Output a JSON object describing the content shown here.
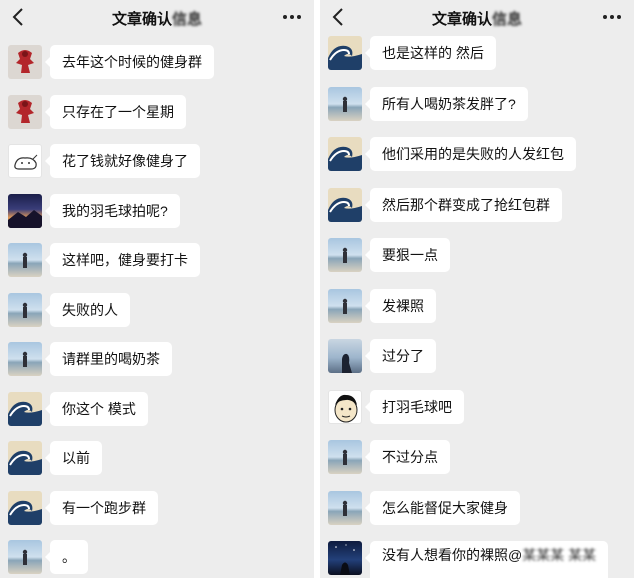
{
  "left": {
    "title": "文章确认",
    "title_blur": "信息",
    "messages": [
      {
        "avatar": "red-figure-avatar",
        "text": "去年这个时候的健身群"
      },
      {
        "avatar": "red-figure-avatar",
        "text": "只存在了一个星期"
      },
      {
        "avatar": "dog-sketch-avatar",
        "text": "花了钱就好像健身了"
      },
      {
        "avatar": "dusk-landscape-avatar",
        "text": "我的羽毛球拍呢?"
      },
      {
        "avatar": "beach-person-avatar",
        "text": "这样吧，健身要打卡"
      },
      {
        "avatar": "beach-person-avatar",
        "text": "失败的人"
      },
      {
        "avatar": "beach-person-avatar",
        "text": "请群里的喝奶茶"
      },
      {
        "avatar": "great-wave-avatar",
        "text": "你这个 模式"
      },
      {
        "avatar": "great-wave-avatar",
        "text": "以前"
      },
      {
        "avatar": "great-wave-avatar",
        "text": "有一个跑步群"
      },
      {
        "avatar": "beach-person-avatar",
        "text": "。"
      }
    ]
  },
  "right": {
    "title": "文章确认",
    "title_blur": "信息",
    "messages": [
      {
        "avatar": "great-wave-avatar",
        "text": "也是这样的 然后"
      },
      {
        "avatar": "beach-person-avatar",
        "text": "所有人喝奶茶发胖了?"
      },
      {
        "avatar": "great-wave-avatar",
        "text": "他们采用的是失败的人发红包"
      },
      {
        "avatar": "great-wave-avatar",
        "text": "然后那个群变成了抢红包群"
      },
      {
        "avatar": "beach-person-avatar",
        "text": "要狠一点"
      },
      {
        "avatar": "beach-person-avatar",
        "text": "发裸照"
      },
      {
        "avatar": "sky-silhouette-avatar",
        "text": "过分了"
      },
      {
        "avatar": "cartoon-face-avatar",
        "text": "打羽毛球吧"
      },
      {
        "avatar": "beach-person-avatar",
        "text": "不过分点"
      },
      {
        "avatar": "beach-person-avatar",
        "text": "怎么能督促大家健身"
      },
      {
        "avatar": "night-sky-avatar",
        "text": "没有人想看你的裸照@",
        "blur": "某某某 某某"
      }
    ]
  },
  "icons": {
    "back": "chevron-left-icon",
    "more": "more-dots-icon"
  },
  "colors": {
    "background": "#ededed",
    "bubble": "#ffffff",
    "text": "#111111"
  }
}
